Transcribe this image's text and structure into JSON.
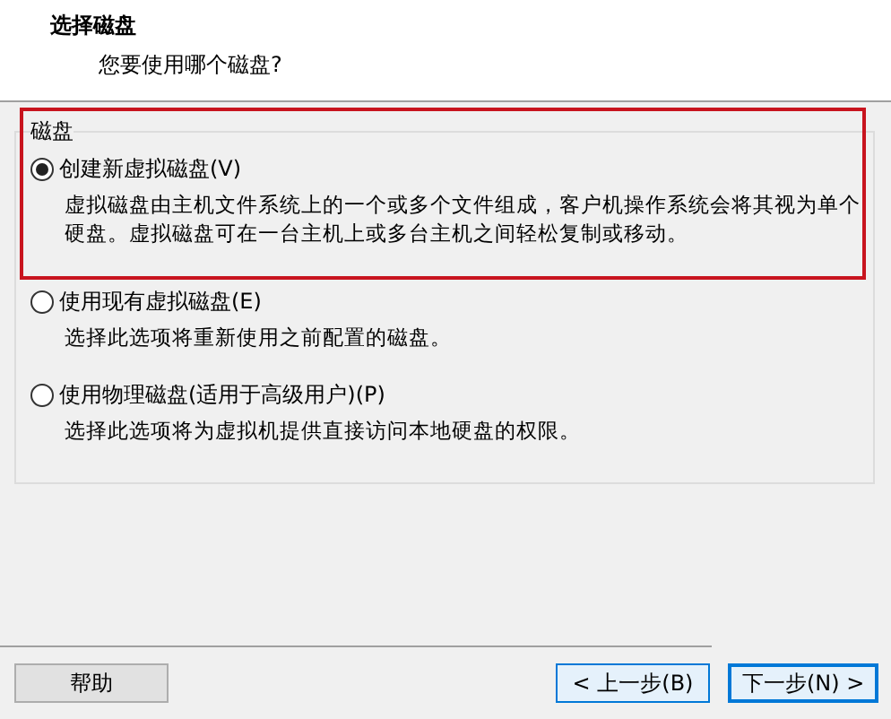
{
  "header": {
    "title": "选择磁盘",
    "subtitle": "您要使用哪个磁盘?"
  },
  "group": {
    "label": "磁盘",
    "options": [
      {
        "label": "创建新虚拟磁盘(V)",
        "description": "虚拟磁盘由主机文件系统上的一个或多个文件组成，客户机操作系统会将其视为单个硬盘。虚拟磁盘可在一台主机上或多台主机之间轻松复制或移动。",
        "selected": true,
        "highlighted": true
      },
      {
        "label": "使用现有虚拟磁盘(E)",
        "description": "选择此选项将重新使用之前配置的磁盘。",
        "selected": false,
        "highlighted": false
      },
      {
        "label": "使用物理磁盘(适用于高级用户)(P)",
        "description": "选择此选项将为虚拟机提供直接访问本地硬盘的权限。",
        "selected": false,
        "highlighted": false
      }
    ]
  },
  "buttons": [
    {
      "label": "帮助",
      "kind": "plain"
    },
    {
      "label": "< 上一步(B)",
      "kind": "nav"
    },
    {
      "label": "下一步(N) >",
      "kind": "default"
    }
  ]
}
